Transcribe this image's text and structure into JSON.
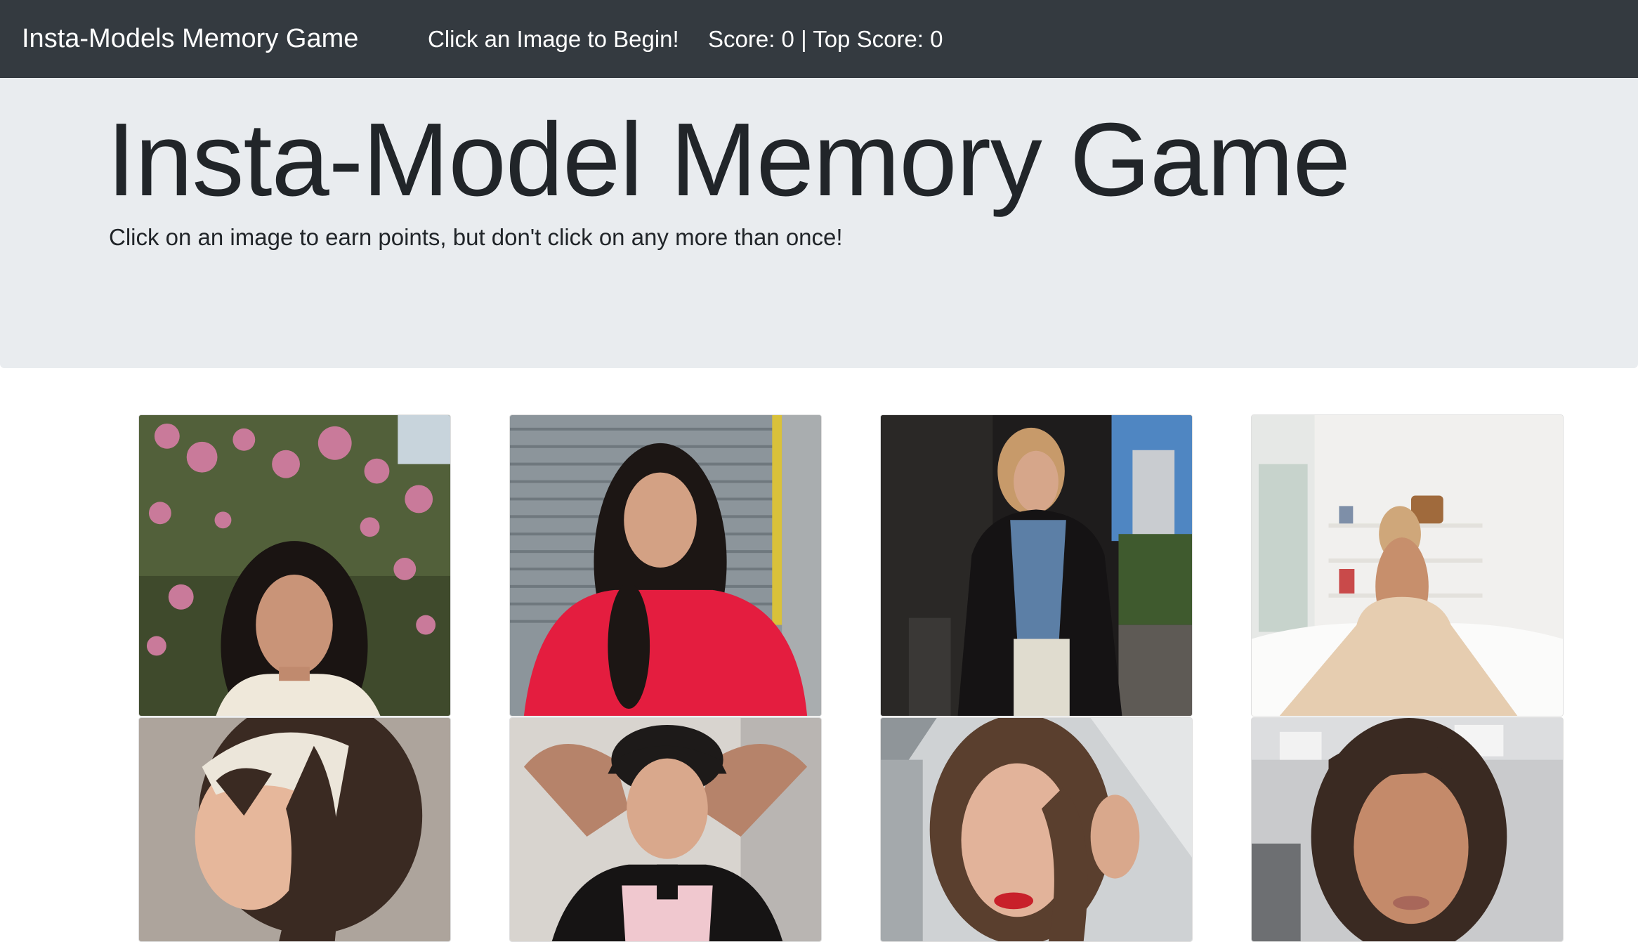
{
  "navbar": {
    "brand": "Insta-Models Memory Game",
    "status": "Click an Image to Begin!",
    "score_text": "Score: 0 | Top Score: 0"
  },
  "jumbotron": {
    "title": "Insta-Model Memory Game",
    "subtitle": "Click on an image to earn points, but don't click on any more than once!"
  },
  "cards": [
    {
      "scene": "model in front of pink bougainvillea bush"
    },
    {
      "scene": "model in red sweater by metal shutter"
    },
    {
      "scene": "model in denim shirt and black jacket on street"
    },
    {
      "scene": "model in gown on white bed"
    },
    {
      "scene": "model with white headband"
    },
    {
      "scene": "model in cap with arms raised"
    },
    {
      "scene": "model with red lipstick"
    },
    {
      "scene": "model with dark wavy hair selfie"
    }
  ],
  "colors": {
    "navbar_bg": "#343a40",
    "jumbotron_bg": "#e9ecef",
    "text_dark": "#212529"
  }
}
